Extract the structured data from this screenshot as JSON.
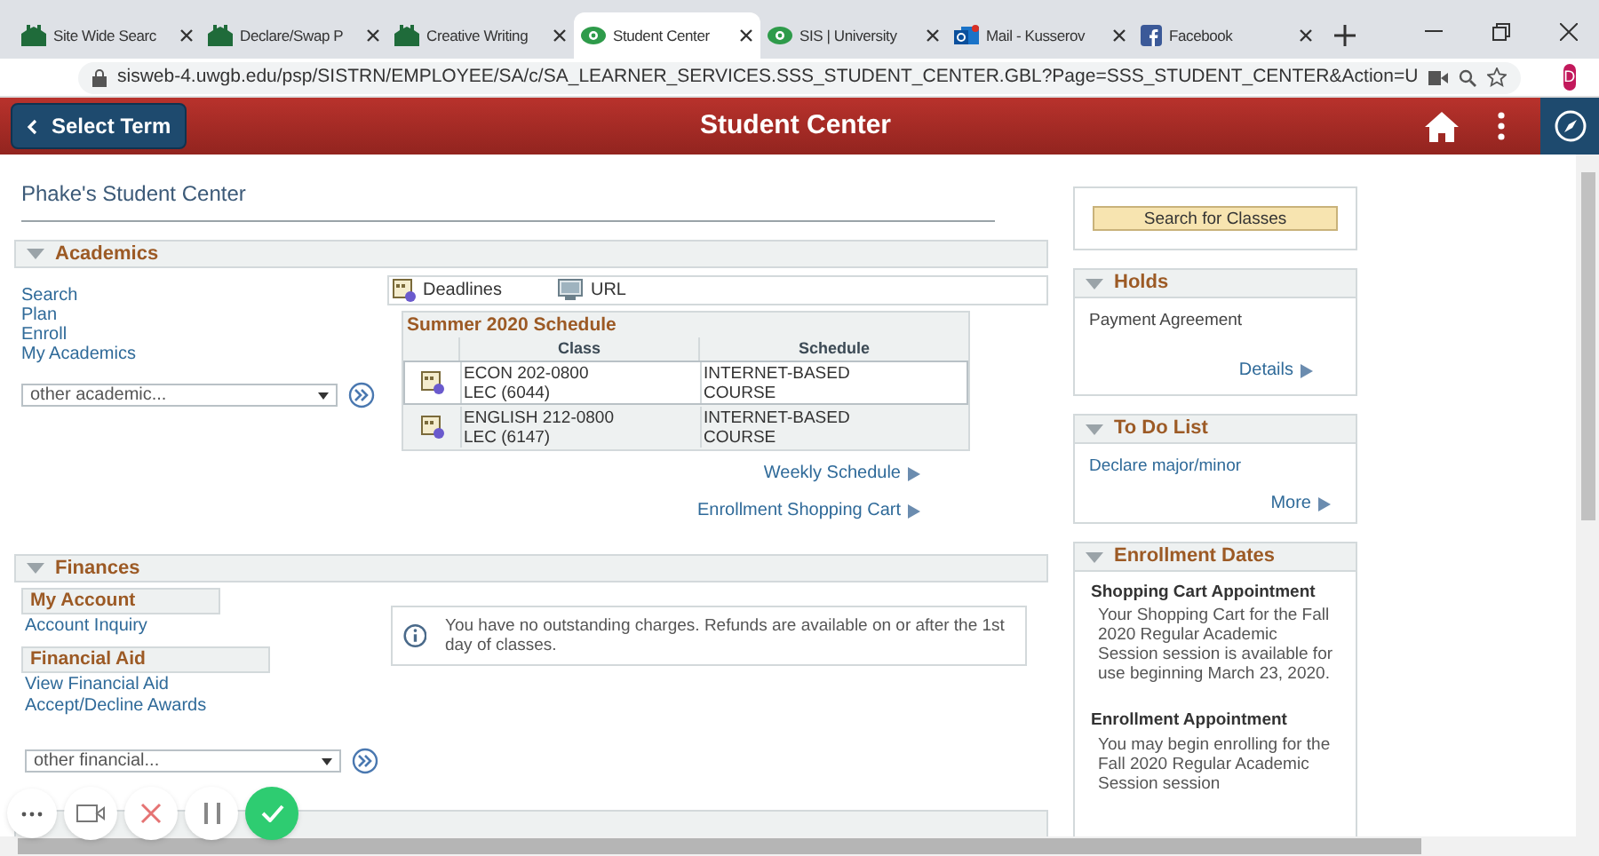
{
  "browser": {
    "tabs": [
      {
        "title": "Site Wide Searc",
        "kind": "school",
        "selected": false
      },
      {
        "title": "Declare/Swap P",
        "kind": "school",
        "selected": false
      },
      {
        "title": "Creative Writing",
        "kind": "school",
        "selected": false
      },
      {
        "title": "Student Center",
        "kind": "eye",
        "selected": true
      },
      {
        "title": "SIS | University",
        "kind": "eye",
        "selected": false
      },
      {
        "title": "Mail - Kusserov",
        "kind": "mail",
        "selected": false
      },
      {
        "title": "Facebook",
        "kind": "facebook",
        "selected": false
      }
    ],
    "url": "sisweb-4.uwgb.edu/psp/SISTRN/EMPLOYEE/SA/c/SA_LEARNER_SERVICES.SSS_STUDENT_CENTER.GBL?Page=SSS_STUDENT_CENTER&Action=U",
    "profile_initial": "D"
  },
  "header": {
    "back_button": "Select Term",
    "title": "Student Center"
  },
  "page_title": "Phake's Student Center",
  "academics": {
    "title": "Academics",
    "links": [
      "Search",
      "Plan",
      "Enroll",
      "My Academics"
    ],
    "dropdown": "other academic...",
    "toolbar": [
      {
        "label": "Deadlines",
        "kind": "deadlines"
      },
      {
        "label": "URL",
        "kind": "url"
      }
    ],
    "schedule": {
      "title": "Summer 2020 Schedule",
      "columns": [
        "Class",
        "Schedule"
      ],
      "rows": [
        {
          "class": [
            "ECON 202-0800",
            "LEC (6044)"
          ],
          "schedule": [
            "INTERNET-BASED",
            "COURSE"
          ],
          "selected": true
        },
        {
          "class": [
            "ENGLISH 212-0800",
            "LEC (6147)"
          ],
          "schedule": [
            "INTERNET-BASED",
            "COURSE"
          ],
          "selected": false
        }
      ]
    },
    "footer_links": [
      "Weekly Schedule",
      "Enrollment Shopping Cart"
    ]
  },
  "finances": {
    "title": "Finances",
    "groups": [
      {
        "title": "My Account",
        "links": [
          "Account Inquiry"
        ]
      },
      {
        "title": "Financial Aid",
        "links": [
          "View Financial Aid",
          "Accept/Decline Awards"
        ]
      }
    ],
    "dropdown": "other financial...",
    "message": "You have no outstanding charges. Refunds are available on or after the 1st day of classes."
  },
  "sidebar": {
    "search_button": "Search for Classes",
    "holds": {
      "title": "Holds",
      "items": [
        "Payment Agreement"
      ],
      "link": "Details"
    },
    "todo": {
      "title": "To Do List",
      "items": [
        "Declare major/minor"
      ],
      "link": "More"
    },
    "enrollment_dates": {
      "title": "Enrollment Dates",
      "entries": [
        {
          "title": "Shopping Cart Appointment",
          "text": "Your Shopping Cart for the Fall 2020 Regular Academic Session session is available for use beginning March 23, 2020."
        },
        {
          "title": "Enrollment Appointment",
          "text": "You may begin enrolling for the Fall 2020 Regular Academic Session session"
        }
      ]
    }
  }
}
